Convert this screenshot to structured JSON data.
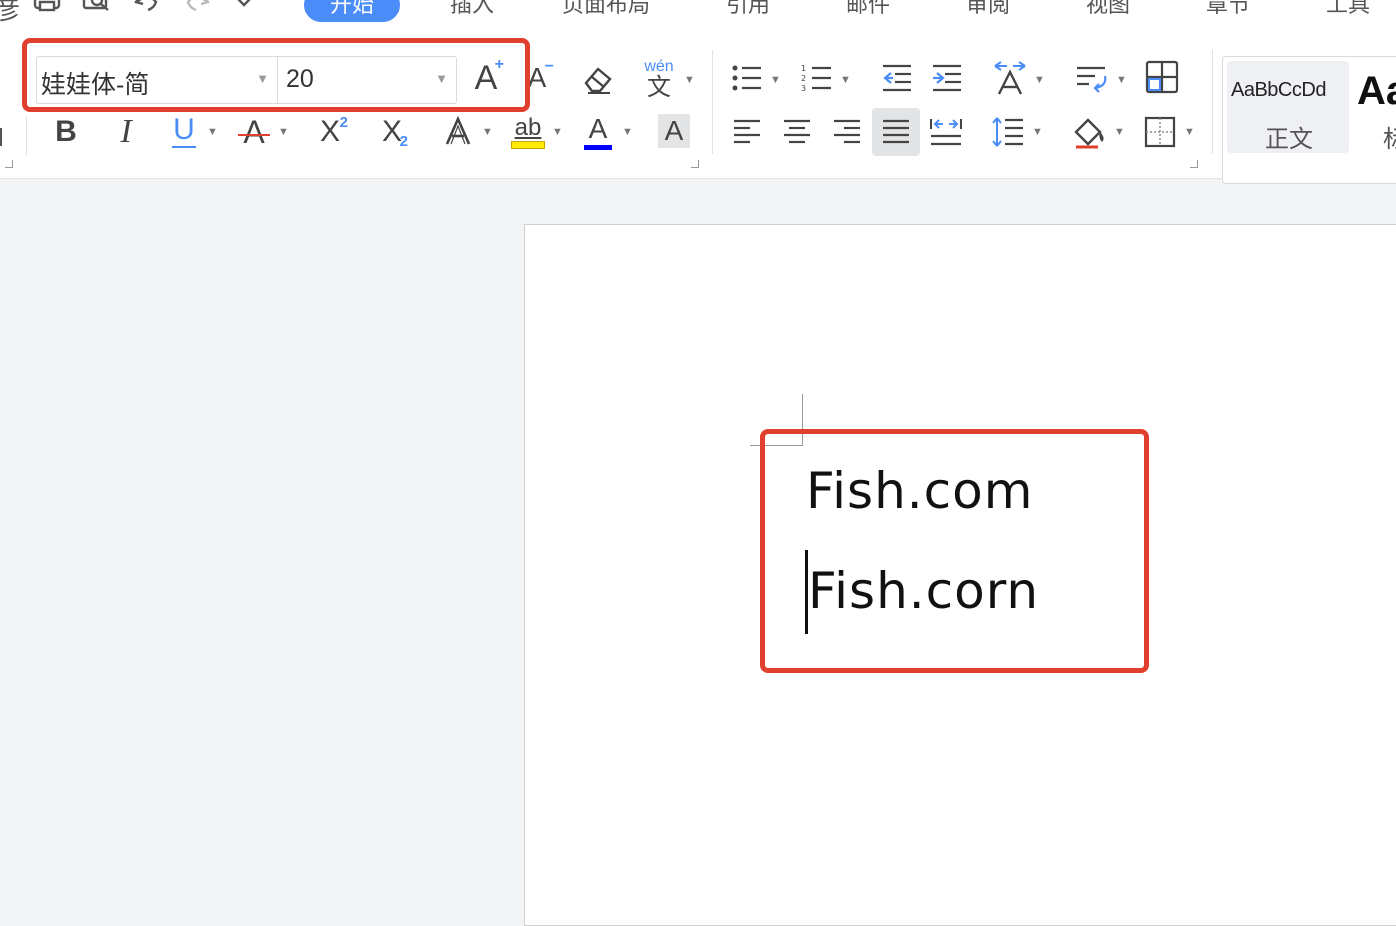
{
  "quick_access": {
    "left_partial": "彦",
    "print_icon": "printer-icon",
    "preview_icon": "print-preview-icon",
    "undo_icon": "undo-icon",
    "redo_icon": "redo-icon",
    "more_icon": "chevron-down-icon"
  },
  "tabs": [
    {
      "label": "开始",
      "active": true
    },
    {
      "label": "插入",
      "active": false
    },
    {
      "label": "页面布局",
      "active": false
    },
    {
      "label": "引用",
      "active": false
    },
    {
      "label": "邮件",
      "active": false
    },
    {
      "label": "审阅",
      "active": false
    },
    {
      "label": "视图",
      "active": false
    },
    {
      "label": "章节",
      "active": false
    },
    {
      "label": "工具",
      "active": false
    }
  ],
  "font": {
    "name": "娃娃体-简",
    "size": "20"
  },
  "format_buttons": {
    "bold": "B",
    "italic": "I",
    "underline": "U",
    "strike": "A",
    "superscript": "X",
    "superscript_mark": "2",
    "subscript": "X",
    "subscript_mark": "2",
    "text_effect": "A",
    "highlight": "ab",
    "font_color": "A",
    "char_shading": "A",
    "grow": "A",
    "grow_mark": "+",
    "shrink": "A",
    "shrink_mark": "−",
    "phonetic_top": "wén",
    "phonetic_bottom": "文"
  },
  "styles": {
    "normal_preview": "AaBbCcDd",
    "normal_label": "正文",
    "heading_preview": "Aa",
    "heading_label": "标"
  },
  "colors": {
    "accent": "#4a8df8",
    "highlight_box": "#e2402f",
    "highlight_yellow": "#ffec00",
    "font_color_blue": "#0000ff"
  },
  "document": {
    "lines": [
      "Fish.com",
      "Fish.corn"
    ]
  }
}
